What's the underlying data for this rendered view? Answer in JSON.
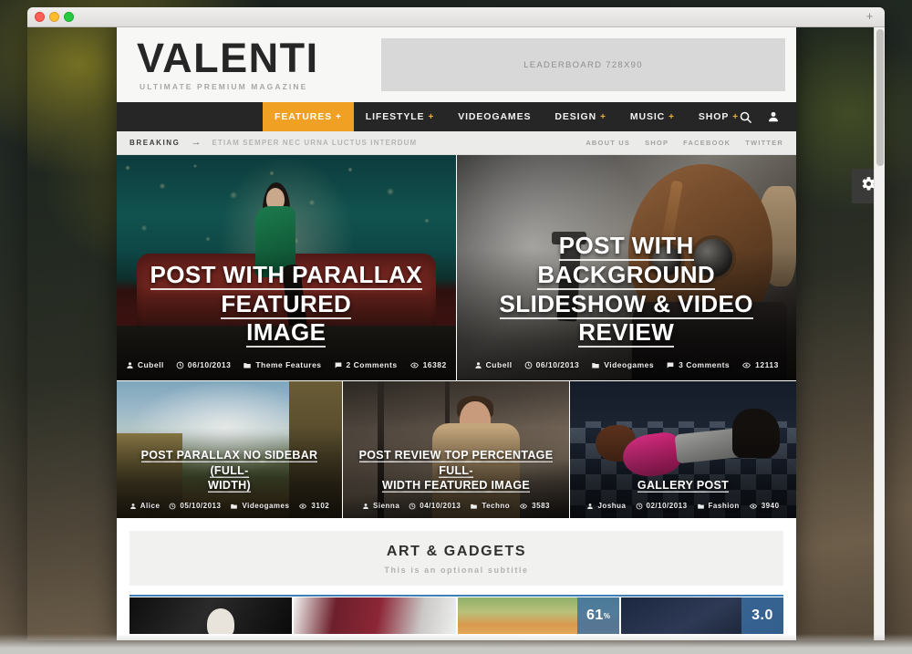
{
  "window": {
    "traffic_lights": [
      "close",
      "minimize",
      "zoom"
    ],
    "new_tab_label": "+"
  },
  "header": {
    "brand_title": "VALENTI",
    "brand_tagline": "ULTIMATE PREMIUM MAGAZINE",
    "ad_label": "LEADERBOARD 728X90"
  },
  "nav": {
    "items": [
      {
        "label": "FEATURES",
        "has_children": true,
        "active": true
      },
      {
        "label": "LIFESTYLE",
        "has_children": true,
        "active": false
      },
      {
        "label": "VIDEOGAMES",
        "has_children": false,
        "active": false
      },
      {
        "label": "DESIGN",
        "has_children": true,
        "active": false
      },
      {
        "label": "MUSIC",
        "has_children": true,
        "active": false
      },
      {
        "label": "SHOP",
        "has_children": true,
        "active": false
      }
    ],
    "accent_color": "#f0a023",
    "bar_color": "#262626",
    "search_icon": "search-icon",
    "account_icon": "user-icon"
  },
  "breaking": {
    "label": "BREAKING",
    "arrow": "→",
    "headline": "ETIAM SEMPER NEC URNA LUCTUS INTERDUM",
    "top_links": [
      "ABOUT US",
      "SHOP",
      "FACEBOOK",
      "TWITTER"
    ]
  },
  "heroes": [
    {
      "title_lines": [
        "POST WITH PARALLAX FEATURED",
        "IMAGE"
      ],
      "author": "Cubell",
      "date": "06/10/2013",
      "category": "Theme Features",
      "comments": "2 Comments",
      "views": "16382"
    },
    {
      "title_lines": [
        "POST WITH BACKGROUND",
        "SLIDESHOW & VIDEO REVIEW"
      ],
      "author": "Cubell",
      "date": "06/10/2013",
      "category": "Videogames",
      "comments": "3 Comments",
      "views": "12113"
    }
  ],
  "cards": [
    {
      "title_lines": [
        "POST PARALLAX NO SIDEBAR (FULL-",
        "WIDTH)"
      ],
      "author": "Alice",
      "date": "05/10/2013",
      "category": "Videogames",
      "views": "3102"
    },
    {
      "title_lines": [
        "POST REVIEW TOP PERCENTAGE FULL-",
        "WIDTH FEATURED IMAGE"
      ],
      "author": "Sienna",
      "date": "04/10/2013",
      "category": "Techno",
      "views": "3583"
    },
    {
      "title_lines": [
        "GALLERY POST"
      ],
      "author": "Joshua",
      "date": "02/10/2013",
      "category": "Fashion",
      "views": "3940"
    }
  ],
  "section": {
    "title": "ART & GADGETS",
    "subtitle": "This is an optional subtitle",
    "rule_color": "#3f7fb8",
    "thumbs": [
      {
        "score": "",
        "score_suffix": ""
      },
      {
        "score": "",
        "score_suffix": ""
      },
      {
        "score": "61",
        "score_suffix": "%"
      },
      {
        "score": "3.0",
        "score_suffix": ""
      }
    ]
  },
  "settings_tab": {
    "icon": "gear-icon"
  }
}
